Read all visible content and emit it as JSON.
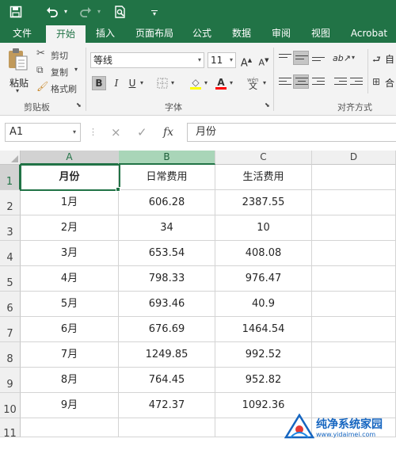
{
  "qat": {
    "save_icon": "save-icon",
    "undo_icon": "undo-icon",
    "redo_icon": "redo-icon",
    "preview_icon": "print-preview-icon",
    "customize_icon": "customize-qat-icon"
  },
  "tabs": [
    {
      "label": "文件"
    },
    {
      "label": "开始"
    },
    {
      "label": "插入"
    },
    {
      "label": "页面布局"
    },
    {
      "label": "公式"
    },
    {
      "label": "数据"
    },
    {
      "label": "审阅"
    },
    {
      "label": "视图"
    },
    {
      "label": "Acrobat"
    }
  ],
  "ribbon": {
    "clipboard": {
      "paste_label": "粘贴",
      "cut_label": "剪切",
      "copy_label": "复制",
      "format_painter_label": "格式刷",
      "group_label": "剪贴板"
    },
    "font": {
      "font_name": "等线",
      "font_size": "11",
      "grow_label": "A",
      "shrink_label": "A",
      "bold_label": "B",
      "italic_label": "I",
      "underline_label": "U",
      "fill_label": "A",
      "font_color_label": "A",
      "phonetic_label": "wén",
      "group_label": "字体"
    },
    "alignment": {
      "wrap_label": "自",
      "merge_label": "合",
      "group_label": "对齐方式"
    }
  },
  "formula_bar": {
    "name_box": "A1",
    "cancel_icon": "×",
    "enter_icon": "✓",
    "fx_label": "fx",
    "content": "月份"
  },
  "sheet": {
    "columns": [
      "A",
      "B",
      "C",
      "D"
    ],
    "row_numbers": [
      "1",
      "2",
      "3",
      "4",
      "5",
      "6",
      "7",
      "8",
      "9",
      "10",
      "11"
    ],
    "rows": [
      [
        "月份",
        "日常费用",
        "生活费用"
      ],
      [
        "1月",
        "606.28",
        "2387.55"
      ],
      [
        "2月",
        "34",
        "10"
      ],
      [
        "3月",
        "653.54",
        "408.08"
      ],
      [
        "4月",
        "798.33",
        "976.47"
      ],
      [
        "5月",
        "693.46",
        "40.9"
      ],
      [
        "6月",
        "676.69",
        "1464.54"
      ],
      [
        "7月",
        "1249.85",
        "992.52"
      ],
      [
        "8月",
        "764.45",
        "952.82"
      ],
      [
        "9月",
        "472.37",
        "1092.36"
      ]
    ],
    "active_cell": "A1"
  },
  "watermark": {
    "text": "纯净系统家园",
    "url": "www.yidaimei.com"
  }
}
